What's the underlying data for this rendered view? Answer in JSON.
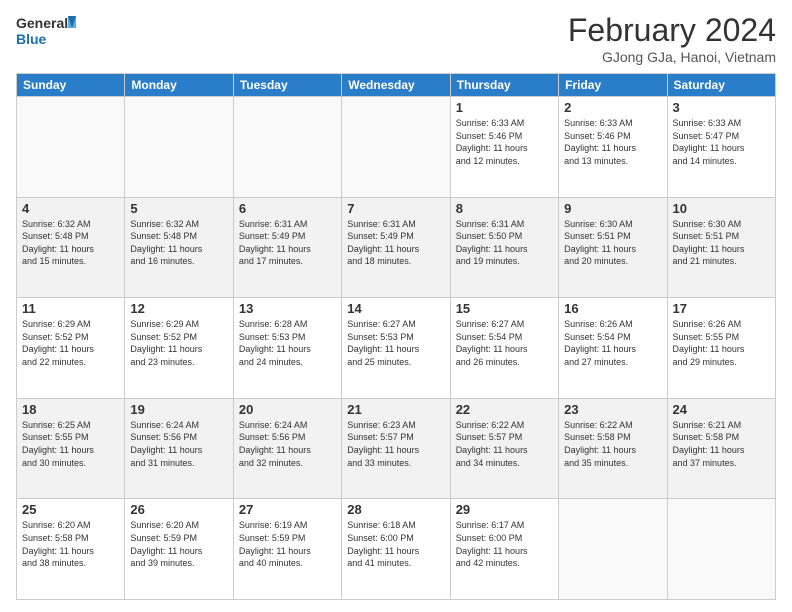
{
  "logo": {
    "line1": "General",
    "line2": "Blue"
  },
  "title": "February 2024",
  "location": "GJong GJa, Hanoi, Vietnam",
  "days_header": [
    "Sunday",
    "Monday",
    "Tuesday",
    "Wednesday",
    "Thursday",
    "Friday",
    "Saturday"
  ],
  "weeks": [
    {
      "shade": false,
      "days": [
        {
          "num": "",
          "info": ""
        },
        {
          "num": "",
          "info": ""
        },
        {
          "num": "",
          "info": ""
        },
        {
          "num": "",
          "info": ""
        },
        {
          "num": "1",
          "info": "Sunrise: 6:33 AM\nSunset: 5:46 PM\nDaylight: 11 hours\nand 12 minutes."
        },
        {
          "num": "2",
          "info": "Sunrise: 6:33 AM\nSunset: 5:46 PM\nDaylight: 11 hours\nand 13 minutes."
        },
        {
          "num": "3",
          "info": "Sunrise: 6:33 AM\nSunset: 5:47 PM\nDaylight: 11 hours\nand 14 minutes."
        }
      ]
    },
    {
      "shade": true,
      "days": [
        {
          "num": "4",
          "info": "Sunrise: 6:32 AM\nSunset: 5:48 PM\nDaylight: 11 hours\nand 15 minutes."
        },
        {
          "num": "5",
          "info": "Sunrise: 6:32 AM\nSunset: 5:48 PM\nDaylight: 11 hours\nand 16 minutes."
        },
        {
          "num": "6",
          "info": "Sunrise: 6:31 AM\nSunset: 5:49 PM\nDaylight: 11 hours\nand 17 minutes."
        },
        {
          "num": "7",
          "info": "Sunrise: 6:31 AM\nSunset: 5:49 PM\nDaylight: 11 hours\nand 18 minutes."
        },
        {
          "num": "8",
          "info": "Sunrise: 6:31 AM\nSunset: 5:50 PM\nDaylight: 11 hours\nand 19 minutes."
        },
        {
          "num": "9",
          "info": "Sunrise: 6:30 AM\nSunset: 5:51 PM\nDaylight: 11 hours\nand 20 minutes."
        },
        {
          "num": "10",
          "info": "Sunrise: 6:30 AM\nSunset: 5:51 PM\nDaylight: 11 hours\nand 21 minutes."
        }
      ]
    },
    {
      "shade": false,
      "days": [
        {
          "num": "11",
          "info": "Sunrise: 6:29 AM\nSunset: 5:52 PM\nDaylight: 11 hours\nand 22 minutes."
        },
        {
          "num": "12",
          "info": "Sunrise: 6:29 AM\nSunset: 5:52 PM\nDaylight: 11 hours\nand 23 minutes."
        },
        {
          "num": "13",
          "info": "Sunrise: 6:28 AM\nSunset: 5:53 PM\nDaylight: 11 hours\nand 24 minutes."
        },
        {
          "num": "14",
          "info": "Sunrise: 6:27 AM\nSunset: 5:53 PM\nDaylight: 11 hours\nand 25 minutes."
        },
        {
          "num": "15",
          "info": "Sunrise: 6:27 AM\nSunset: 5:54 PM\nDaylight: 11 hours\nand 26 minutes."
        },
        {
          "num": "16",
          "info": "Sunrise: 6:26 AM\nSunset: 5:54 PM\nDaylight: 11 hours\nand 27 minutes."
        },
        {
          "num": "17",
          "info": "Sunrise: 6:26 AM\nSunset: 5:55 PM\nDaylight: 11 hours\nand 29 minutes."
        }
      ]
    },
    {
      "shade": true,
      "days": [
        {
          "num": "18",
          "info": "Sunrise: 6:25 AM\nSunset: 5:55 PM\nDaylight: 11 hours\nand 30 minutes."
        },
        {
          "num": "19",
          "info": "Sunrise: 6:24 AM\nSunset: 5:56 PM\nDaylight: 11 hours\nand 31 minutes."
        },
        {
          "num": "20",
          "info": "Sunrise: 6:24 AM\nSunset: 5:56 PM\nDaylight: 11 hours\nand 32 minutes."
        },
        {
          "num": "21",
          "info": "Sunrise: 6:23 AM\nSunset: 5:57 PM\nDaylight: 11 hours\nand 33 minutes."
        },
        {
          "num": "22",
          "info": "Sunrise: 6:22 AM\nSunset: 5:57 PM\nDaylight: 11 hours\nand 34 minutes."
        },
        {
          "num": "23",
          "info": "Sunrise: 6:22 AM\nSunset: 5:58 PM\nDaylight: 11 hours\nand 35 minutes."
        },
        {
          "num": "24",
          "info": "Sunrise: 6:21 AM\nSunset: 5:58 PM\nDaylight: 11 hours\nand 37 minutes."
        }
      ]
    },
    {
      "shade": false,
      "days": [
        {
          "num": "25",
          "info": "Sunrise: 6:20 AM\nSunset: 5:58 PM\nDaylight: 11 hours\nand 38 minutes."
        },
        {
          "num": "26",
          "info": "Sunrise: 6:20 AM\nSunset: 5:59 PM\nDaylight: 11 hours\nand 39 minutes."
        },
        {
          "num": "27",
          "info": "Sunrise: 6:19 AM\nSunset: 5:59 PM\nDaylight: 11 hours\nand 40 minutes."
        },
        {
          "num": "28",
          "info": "Sunrise: 6:18 AM\nSunset: 6:00 PM\nDaylight: 11 hours\nand 41 minutes."
        },
        {
          "num": "29",
          "info": "Sunrise: 6:17 AM\nSunset: 6:00 PM\nDaylight: 11 hours\nand 42 minutes."
        },
        {
          "num": "",
          "info": ""
        },
        {
          "num": "",
          "info": ""
        }
      ]
    }
  ]
}
